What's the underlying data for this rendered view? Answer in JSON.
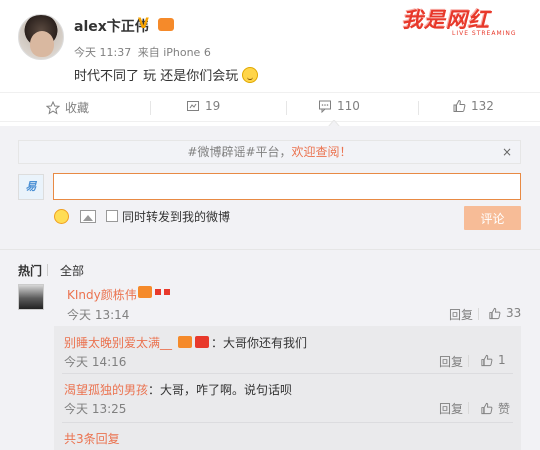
{
  "post": {
    "author": "alex卞正伟",
    "v_badge": "V",
    "time": "今天 11:37",
    "source": "来自 iPhone 6",
    "text": "时代不同了 玩 还是你们会玩",
    "watermark": "我是网红",
    "watermark_sub": "LIVE STREAMING"
  },
  "actions": {
    "favorite_label": "收藏",
    "repost_count": "19",
    "comment_count": "110",
    "like_count": "132"
  },
  "comment_box": {
    "notice_prefix": "#微博辟谣#平台，",
    "notice_link": "欢迎查阅！",
    "notice_close": "×",
    "me_avatar_text": "易",
    "input_value": "",
    "repost_label": "同时转发到我的微博",
    "submit_label": "评论"
  },
  "sort": {
    "hot": "热门",
    "all": "全部"
  },
  "comments": [
    {
      "name": "KIndy颜栋伟",
      "time": "今天 13:14",
      "reply_label": "回复",
      "like_count": "33",
      "replies": [
        {
          "name": "别睡太晚别爱太满__",
          "text": "：大哥你还有我们",
          "time": "今天 14:16",
          "reply_label": "回复",
          "like_count": "1"
        },
        {
          "name": "渴望孤独的男孩",
          "text": "：大哥，咋了啊。说句话呗",
          "time": "今天 13:25",
          "reply_label": "回复",
          "like_count": "赞"
        }
      ],
      "more_replies": "共3条回复"
    }
  ],
  "colors": {
    "link_orange": "#eb7350",
    "submit_disabled": "#f7bc97",
    "input_border": "#e88a44"
  }
}
